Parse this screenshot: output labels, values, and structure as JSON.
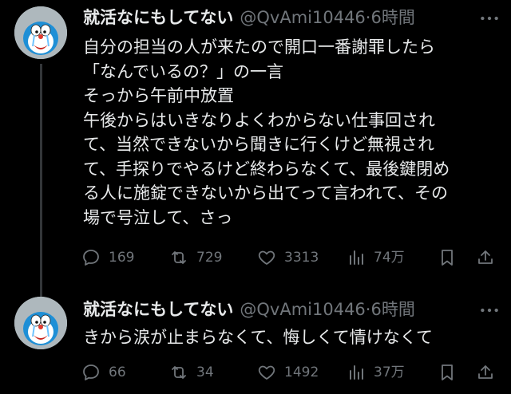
{
  "tweets": [
    {
      "display_name": "就活なにもしてない",
      "handle": "@QvAmi10446",
      "separator": "·",
      "time": "6時間",
      "lines": [
        "自分の担当の人が来たので開口一番謝罪したら",
        "「なんでいるの？」の一言",
        "そっから午前中放置",
        "午後からはいきなりよくわからない仕事回され",
        "て、当然できないから聞きに行くけど無視され",
        "て、手探りでやるけど終わらなくて、最後鍵閉め",
        "る人に施錠できないから出てって言われて、その",
        "場で号泣して、さっ"
      ],
      "replies": "169",
      "reposts": "729",
      "likes": "3313",
      "views": "74万"
    },
    {
      "display_name": "就活なにもしてない",
      "handle": "@QvAmi10446",
      "separator": "·",
      "time": "6時間",
      "lines": [
        "きから涙が止まらなくて、悔しくて情けなくて"
      ],
      "replies": "66",
      "reposts": "34",
      "likes": "1492",
      "views": "37万"
    }
  ],
  "icons": {
    "avatar": "crying-doraemon-avatar",
    "more": "more-horizontal-icon",
    "reply": "reply-bubble-icon",
    "repost": "repost-arrows-icon",
    "like": "heart-icon",
    "views": "views-bar-icon",
    "bookmark": "bookmark-icon",
    "share": "share-upload-icon"
  },
  "colors": {
    "background": "#000000",
    "text": "#e7e9ea",
    "secondary": "#71767b",
    "thread_line": "#333639"
  }
}
